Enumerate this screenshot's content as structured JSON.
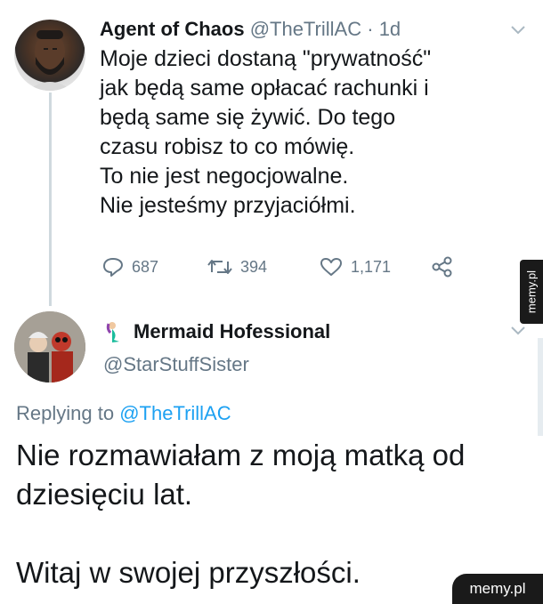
{
  "tweet1": {
    "author_name": "Agent of Chaos",
    "handle": "@TheTrillAC",
    "separator": "·",
    "time": "1d",
    "body_lines": [
      "Moje dzieci dostaną \"prywatność\"",
      "jak będą same opłacać rachunki i",
      "będą same się żywić. Do tego",
      "czasu robisz to co mówię.",
      "To nie jest negocjowalne.",
      "Nie jesteśmy przyjaciółmi."
    ],
    "actions": {
      "replies": "687",
      "retweets": "394",
      "likes": "1,171"
    }
  },
  "tweet2": {
    "author_name": "Mermaid Hofessional",
    "handle": "@StarStuffSister",
    "replying_prefix": "Replying to",
    "replying_to": "@TheTrillAC",
    "body_lines": [
      "Nie rozmawiałam z moją matką od",
      "dziesięciu lat.",
      "",
      "Witaj w swojej przyszłości."
    ]
  },
  "watermark": {
    "side_tab": "memy.pl",
    "badge": "memy.pl"
  },
  "colors": {
    "link": "#1da1f2",
    "secondary": "#657786",
    "text": "#14171a"
  },
  "icons": [
    "reply-icon",
    "retweet-icon",
    "like-icon",
    "share-icon",
    "chevron-down-icon",
    "mermaid-emoji-icon"
  ]
}
